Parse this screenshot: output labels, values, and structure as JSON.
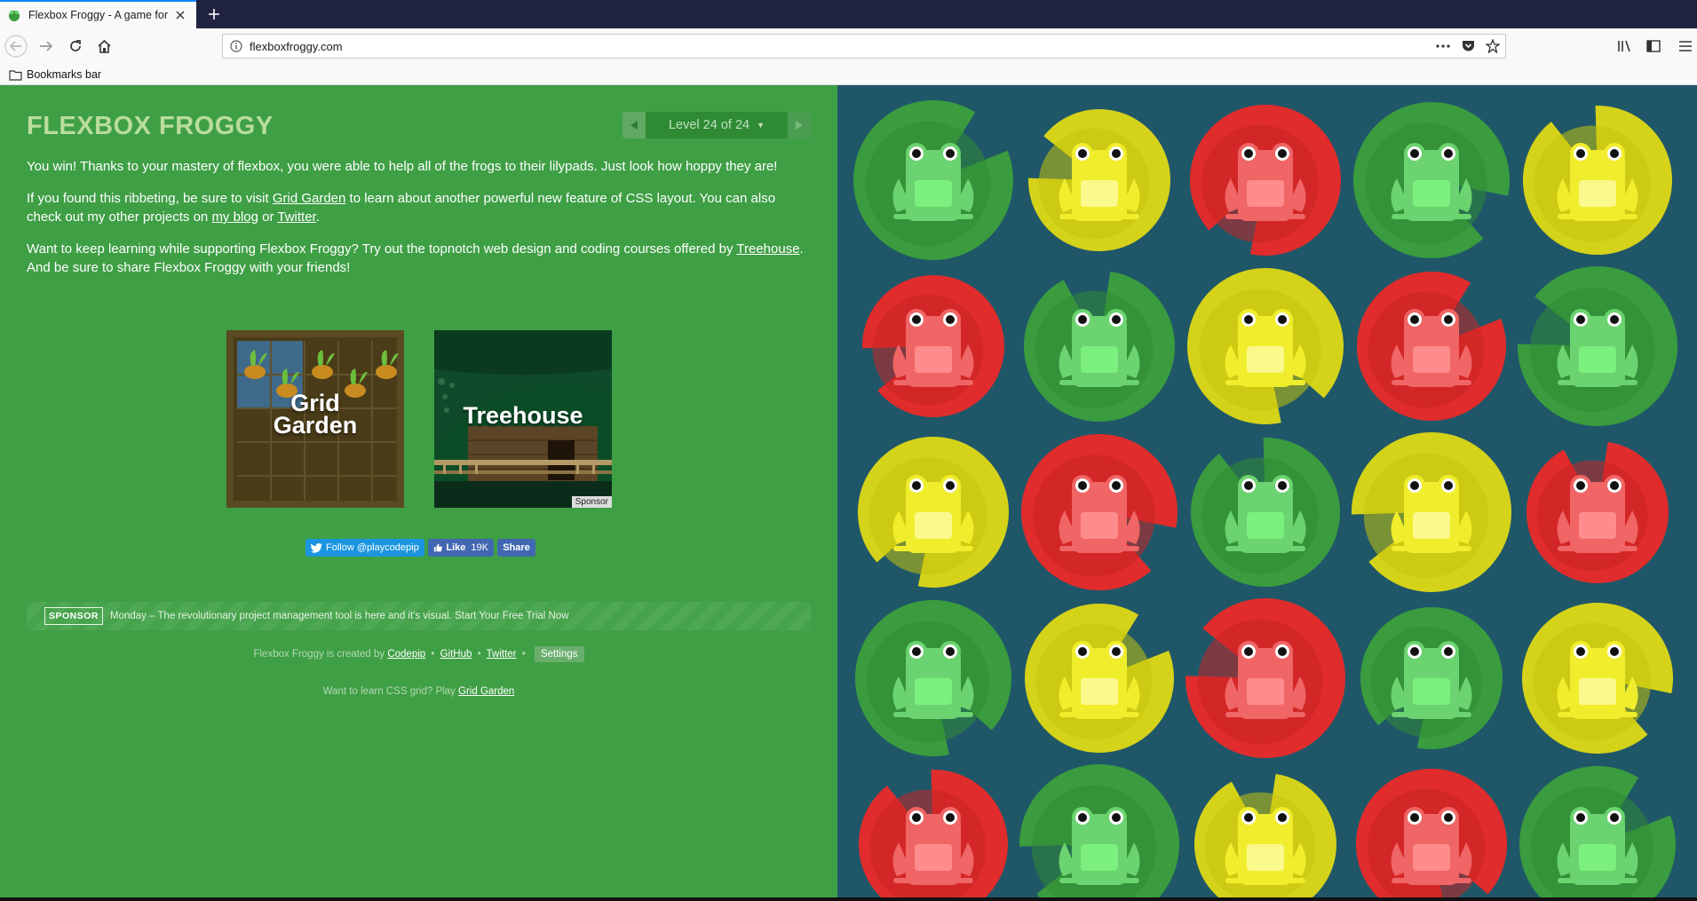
{
  "browser": {
    "tab_title": "Flexbox Froggy - A game for le",
    "url": "flexboxfroggy.com",
    "bookmarks_label": "Bookmarks bar"
  },
  "game": {
    "title": "FLEXBOX FROGGY",
    "level_indicator": "Level 24 of 24",
    "p1": "You win! Thanks to your mastery of flexbox, you were able to help all of the frogs to their lilypads. Just look how hoppy they are!",
    "p2_a": "If you found this ribbeting, be sure to visit ",
    "p2_link1": "Grid Garden",
    "p2_b": " to learn about another powerful new feature of CSS layout. You can also check out my other projects on ",
    "p2_link2": "my blog",
    "p2_c": " or ",
    "p2_link3": "Twitter",
    "p2_d": ".",
    "p3_a": "Want to keep learning while supporting Flexbox Froggy? Try out the topnotch web design and coding courses offered by ",
    "p3_link": "Treehouse",
    "p3_b": ". And be sure to share Flexbox Froggy with your friends!",
    "promo_grid_line1": "Grid",
    "promo_grid_line2": "Garden",
    "promo_tree": "Treehouse",
    "promo_tree_tag": "Sponsor",
    "twitter_label": "Follow @playcodepip",
    "fb_like": "Like",
    "fb_count": "19K",
    "fb_share": "Share",
    "sponsor_badge": "SPONSOR",
    "sponsor_msg": "Monday – The revolutionary project management tool is here and it's visual. Start Your Free Trial Now",
    "credits_prefix": "Flexbox Froggy is created by",
    "credits_codepip": "Codepip",
    "credits_github": "GitHub",
    "credits_twitter": "Twitter",
    "credits_sep": "•",
    "settings_label": "Settings",
    "learn_prefix": "Want to learn CSS grid? Play",
    "learn_link": "Grid Garden"
  },
  "frog_colors": {
    "green": {
      "pad": "#3a9b3f",
      "pad_dark": "#2f8a34",
      "frog": "#6bd36f",
      "belly": "#7cf07e"
    },
    "yellow": {
      "pad": "#d5d21a",
      "pad_dark": "#c5c30d",
      "frog": "#f0ed2c",
      "belly": "#fbf98c"
    },
    "red": {
      "pad": "#e02c2c",
      "pad_dark": "#c82424",
      "frog": "#f06565",
      "belly": "#ff8c8c"
    }
  },
  "board": {
    "rows": [
      [
        "green",
        "yellow",
        "red",
        "green",
        "yellow"
      ],
      [
        "red",
        "green",
        "yellow",
        "red",
        "green"
      ],
      [
        "yellow",
        "red",
        "green",
        "yellow",
        "red"
      ],
      [
        "green",
        "yellow",
        "red",
        "green",
        "yellow"
      ],
      [
        "red",
        "green",
        "yellow",
        "red",
        "green"
      ]
    ]
  }
}
